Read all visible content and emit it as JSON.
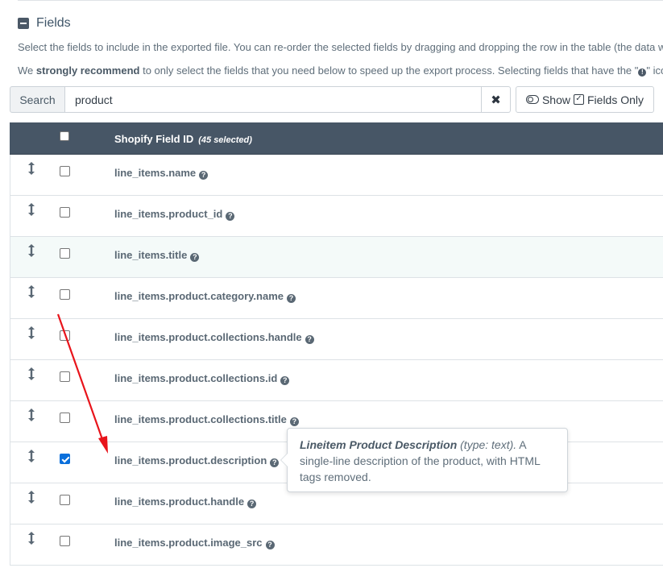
{
  "section": {
    "title": "Fields",
    "collapse_icon": "minus-square-icon"
  },
  "description": {
    "line1": "Select the fields to include in the exported file. You can re-order the selected fields by dragging and dropping the row in the table (the data w",
    "line2_prefix": "We ",
    "line2_bold": "strongly recommend",
    "line2_rest": " to only select the fields that you need below to speed up the export process. Selecting fields that have the \"",
    "line2_icon": "!",
    "line2_tail": "\" ico"
  },
  "search": {
    "label": "Search",
    "value": "product",
    "clear_icon": "✖"
  },
  "show_toggle": {
    "show_label": "Show",
    "fields_only_label": "Fields Only",
    "check_glyph": "✓"
  },
  "table": {
    "header_title": "Shopify Field ID",
    "header_selected": "(45 selected)",
    "help_glyph": "?",
    "rows": [
      {
        "field": "line_items.name",
        "checked": false,
        "highlight": false
      },
      {
        "field": "line_items.product_id",
        "checked": false,
        "highlight": false
      },
      {
        "field": "line_items.title",
        "checked": false,
        "highlight": true
      },
      {
        "field": "line_items.product.category.name",
        "checked": false,
        "highlight": false
      },
      {
        "field": "line_items.product.collections.handle",
        "checked": false,
        "highlight": false
      },
      {
        "field": "line_items.product.collections.id",
        "checked": false,
        "highlight": false
      },
      {
        "field": "line_items.product.collections.title",
        "checked": false,
        "highlight": false
      },
      {
        "field": "line_items.product.description",
        "checked": true,
        "highlight": false
      },
      {
        "field": "line_items.product.handle",
        "checked": false,
        "highlight": false
      },
      {
        "field": "line_items.product.image_src",
        "checked": false,
        "highlight": false
      }
    ]
  },
  "tooltip": {
    "title": "Lineitem Product Description",
    "type": "(type: text).",
    "text_a": " A",
    "text_b": "single-line description of the product, with HTML",
    "text_c": "tags removed."
  },
  "colors": {
    "header_bg": "#475666",
    "checkbox_on": "#0a6fdb",
    "arrow": "#e8141b"
  }
}
